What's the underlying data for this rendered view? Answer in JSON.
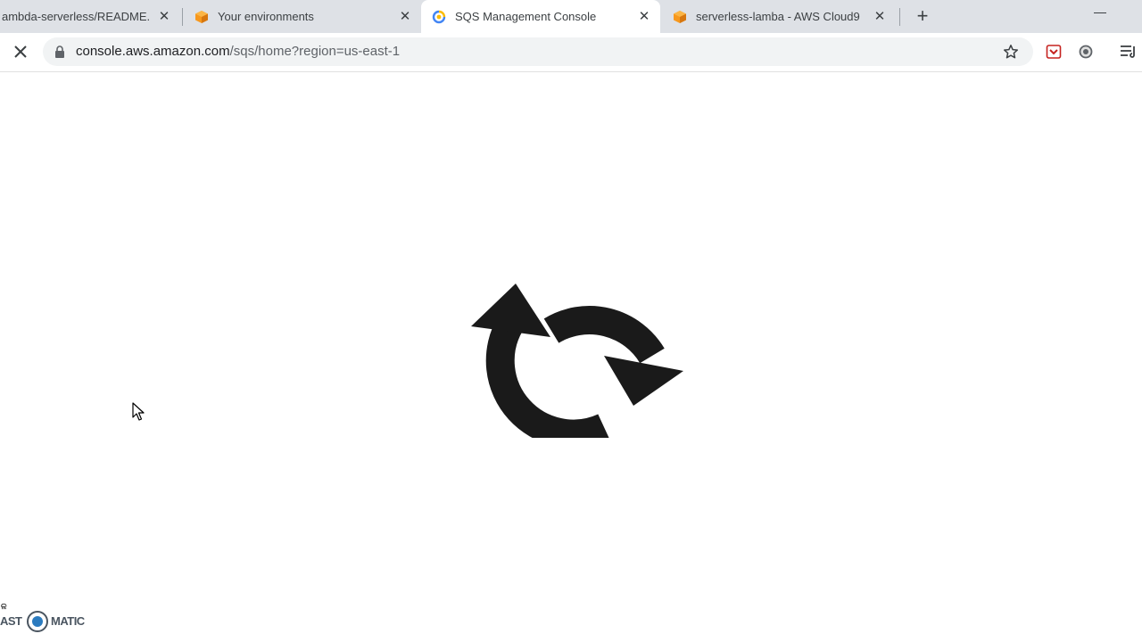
{
  "browser": {
    "tabs": [
      {
        "title": "ambda-serverless/README.m",
        "favicon": "github-icon",
        "active": false
      },
      {
        "title": "Your environments",
        "favicon": "aws-cube-icon",
        "active": false
      },
      {
        "title": "SQS Management Console",
        "favicon": "google-loading-icon",
        "active": true
      },
      {
        "title": "serverless-lamba - AWS Cloud9",
        "favicon": "aws-cube-icon",
        "active": false
      }
    ],
    "new_tab_label": "+",
    "close_glyph": "✕"
  },
  "toolbar": {
    "url_host": "console.aws.amazon.com",
    "url_path": "/sqs/home?region=us-east-1"
  },
  "watermark": {
    "small_text": "ଳ",
    "left_text": "AST",
    "right_text": "MATIC"
  },
  "colors": {
    "tabstrip_bg": "#dee1e6",
    "active_tab_bg": "#ffffff",
    "omnibox_bg": "#f1f3f4",
    "spinner": "#1a1a1a",
    "aws_orange": "#f7981d"
  }
}
